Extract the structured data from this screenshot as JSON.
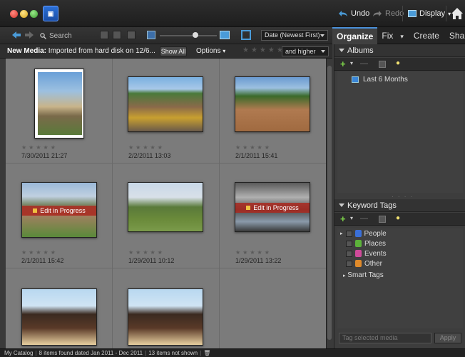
{
  "titlebar": {
    "undo_label": "Undo",
    "redo_label": "Redo",
    "display_label": "Display"
  },
  "toolbar": {
    "search_label": "Search",
    "sort_value": "Date (Newest First)"
  },
  "panel_tabs": [
    {
      "label": "Organize",
      "active": true
    },
    {
      "label": "Fix",
      "active": false
    },
    {
      "label": "Create",
      "active": false
    },
    {
      "label": "Share",
      "active": false
    }
  ],
  "mediabar": {
    "prefix": "New Media:",
    "text": "Imported from hard disk on 12/6...",
    "show_all": "Show All",
    "options": "Options",
    "rating_filter": "and higher"
  },
  "photos": [
    {
      "date": "7/30/2011 21:27",
      "edit_in_progress": false
    },
    {
      "date": "2/2/2011 13:03",
      "edit_in_progress": false
    },
    {
      "date": "2/1/2011 15:41",
      "edit_in_progress": false
    },
    {
      "date": "2/1/2011 15:42",
      "edit_in_progress": true
    },
    {
      "date": "1/29/2011 10:12",
      "edit_in_progress": false
    },
    {
      "date": "1/29/2011 13:22",
      "edit_in_progress": true
    },
    {
      "date": "",
      "edit_in_progress": false
    },
    {
      "date": "",
      "edit_in_progress": false
    }
  ],
  "edit_in_progress_label": "Edit in Progress",
  "albums": {
    "title": "Albums",
    "items": [
      "Last 6 Months"
    ]
  },
  "keyword_tags": {
    "title": "Keyword Tags",
    "items": [
      {
        "label": "People",
        "color": "#3a6fd8"
      },
      {
        "label": "Places",
        "color": "#5cb33a"
      },
      {
        "label": "Events",
        "color": "#d04a9a"
      },
      {
        "label": "Other",
        "color": "#e08a2a"
      }
    ],
    "smart_tags": "Smart Tags"
  },
  "tag_input_placeholder": "Tag selected media",
  "apply_label": "Apply",
  "status": {
    "catalog": "My Catalog",
    "found": "8 items found dated Jan 2011 - Dec 2011",
    "not_shown": "13 items not shown"
  }
}
